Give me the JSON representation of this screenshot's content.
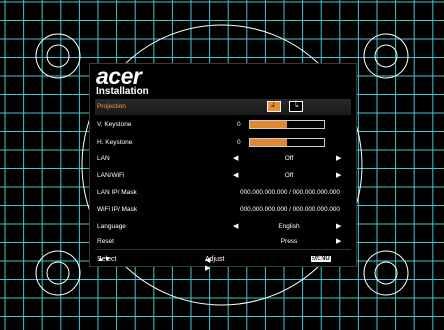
{
  "brand": "acer",
  "menu": {
    "title": "Installation",
    "projection": {
      "label": "Projection",
      "icon_front": "front-projection-icon",
      "icon_rear": "ceiling-projection-icon",
      "selected": true
    },
    "v_keystone": {
      "label": "V. Keystone",
      "value": "0",
      "level": 0.5
    },
    "h_keystone": {
      "label": "H. Keystone",
      "value": "0",
      "level": 0.5
    },
    "lan": {
      "label": "LAN",
      "value": "Off"
    },
    "lan_wifi": {
      "label": "LAN/WiFi",
      "value": "Off"
    },
    "lan_ip": {
      "label": "LAN IP/ Mask",
      "value": "000.000.000.000 / 000.000.000.000"
    },
    "wifi_ip": {
      "label": "WiFi IP/ Mask",
      "value": "000.000.000.000 / 000.000.000.000"
    },
    "language": {
      "label": "Language",
      "value": "English"
    },
    "reset": {
      "label": "Reset",
      "value": "Press"
    }
  },
  "footer": {
    "select": "Select",
    "adjust": "Adjust",
    "menu_key": "MENU",
    "exit": "Exit"
  },
  "colors": {
    "accent": "#e89030",
    "grid": "#40c8d0",
    "background": "#000000"
  }
}
